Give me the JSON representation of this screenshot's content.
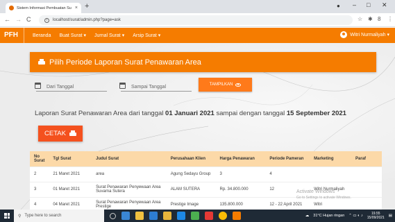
{
  "browser": {
    "tab_title": "Sistem Informasi Pembuatan Su",
    "tab_close": "×",
    "new_tab": "+",
    "url": "localhost/surat/admin.php?page=ask",
    "win_min": "–",
    "win_max": "□",
    "win_close": "✕"
  },
  "navbar": {
    "brand": "PFH",
    "menu": [
      {
        "label": "Beranda"
      },
      {
        "label": "Buat Surat ▾"
      },
      {
        "label": "Jurnal Surat ▾"
      },
      {
        "label": "Arsip Surat ▾"
      }
    ],
    "user": "Witri Nurmaliyah ▾"
  },
  "page": {
    "header_title": "Pilih Periode Laporan Surat Penawaran Area",
    "from_placeholder": "Dari Tanggal",
    "to_placeholder": "Sampai Tanggal",
    "show_button": "TAMPILKAN",
    "report_prefix": "Laporan Surat Penawaran Area dari tanggal ",
    "report_from": "01 Januari 2021",
    "report_mid": " sampai dengan tanggal ",
    "report_to": "15 September 2021",
    "print_button": "CETAK"
  },
  "table": {
    "headers": [
      "No Surat",
      "Tgl Surat",
      "Judul Surat",
      "Perusahaan Klien",
      "Harga Penawaran",
      "Periode Pameran",
      "Marketing",
      "Paraf"
    ],
    "rows": [
      [
        "2",
        "21 Maret 2021",
        "area",
        "Agung Sedayu Group",
        "3",
        "4",
        "",
        ""
      ],
      [
        "3",
        "01 Maret 2021",
        "Surat Penawaran Penyewaan Area Suvarna Sutera",
        "ALAM SUTERA",
        "Rp. 34.800.000",
        "12",
        "Witri Nurmaliyah",
        ""
      ],
      [
        "4",
        "04 Maret 2021",
        "Surat Penawaran Penyewaan Area Prestige",
        "Prestige Image",
        "135.800.000",
        "12 - 22 April 2021",
        "Witri",
        ""
      ]
    ]
  },
  "watermark": {
    "line1": "Activate Windows",
    "line2": "Go to Settings to activate Windows."
  },
  "taskbar": {
    "search": "Type here to search",
    "weather": "31°C  Hujan ringan",
    "time": "19.55",
    "date": "15/09/2021"
  },
  "colors": {
    "brand_orange": "#f57c00",
    "table_header": "#fcd9a8",
    "print_button": "#f4511e"
  }
}
